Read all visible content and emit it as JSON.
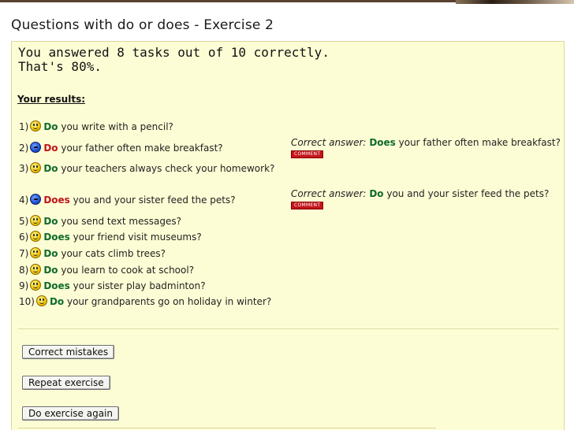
{
  "title": "Questions with do or does - Exercise 2",
  "score": {
    "line1": "You answered 8 tasks out of 10 correctly.",
    "line2": "That's 80%."
  },
  "results_heading": "Your results:",
  "questions": [
    {
      "num": "1)",
      "icon": "smiley-correct-icon",
      "verb": "Do",
      "rest": " you write with a pencil?"
    },
    {
      "num": "2)",
      "icon": "sad-incorrect-icon",
      "verb": "Do",
      "rest": " your father often make breakfast?",
      "correct_label": "Correct answer:",
      "correct_verb": "Does",
      "correct_rest": " your father often make breakfast?",
      "comment": "COMMENT"
    },
    {
      "num": "3)",
      "icon": "smiley-correct-icon",
      "verb": "Do",
      "rest": " your teachers always check your homework?"
    },
    {
      "num": "4)",
      "icon": "sad-incorrect-icon",
      "verb": "Does",
      "rest": " you and your sister feed the pets?",
      "correct_label": "Correct answer:",
      "correct_verb": "Do",
      "correct_rest": " you and your sister feed the pets?",
      "comment": "COMMENT"
    },
    {
      "num": "5)",
      "icon": "smiley-correct-icon",
      "verb": "Do",
      "rest": " you send text messages?"
    },
    {
      "num": "6)",
      "icon": "smiley-correct-icon",
      "verb": "Does",
      "rest": " your friend visit museums?"
    },
    {
      "num": "7)",
      "icon": "smiley-correct-icon",
      "verb": "Do",
      "rest": " your cats climb trees?"
    },
    {
      "num": "8)",
      "icon": "smiley-correct-icon",
      "verb": "Do",
      "rest": " you learn to cook at school?"
    },
    {
      "num": "9)",
      "icon": "smiley-correct-icon",
      "verb": "Does",
      "rest": " your sister play badminton?"
    },
    {
      "num": "10)",
      "icon": "smiley-correct-icon",
      "verb": "Do",
      "rest": " your grandparents go on holiday in winter?"
    }
  ],
  "buttons": {
    "correct_mistakes": "Correct mistakes",
    "repeat_exercise": "Repeat exercise",
    "do_again": "Do exercise again"
  },
  "colors": {
    "correct_verb": "#0f6b2a",
    "wrong_verb": "#c0131a",
    "panel_bg": "#fdfdd5"
  }
}
